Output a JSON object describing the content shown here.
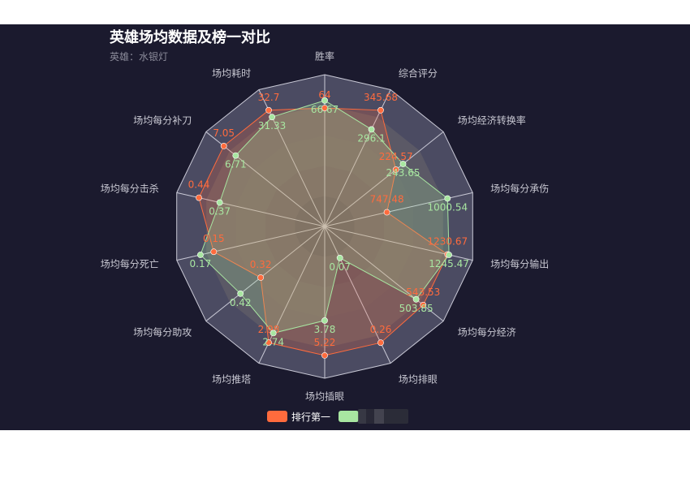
{
  "title": "英雄场均数据及榜一对比",
  "subtitle": "英雄：水银灯",
  "colors": {
    "top": "#ff6b3d",
    "hero": "#a8e6a1",
    "background": "#1b1a2e"
  },
  "legend": [
    {
      "label": "排行第一",
      "color": "#ff6b3d"
    },
    {
      "label": "",
      "color": "#a8e6a1"
    }
  ],
  "chart_data": {
    "type": "radar",
    "indicators": [
      "胜率",
      "综合评分",
      "场均经济转换率",
      "场均每分承伤",
      "场均每分输出",
      "场均每分经济",
      "场均排眼",
      "场均插眼",
      "场均推塔",
      "场均每分助攻",
      "场均每分死亡",
      "场均每分击杀",
      "场均每分补刀",
      "场均耗时"
    ],
    "series": [
      {
        "name": "排行第一",
        "values": [
          64,
          345.68,
          224.57,
          747.48,
          1230.67,
          543.53,
          0.26,
          5.22,
          2.98,
          0.32,
          0.15,
          0.44,
          7.05,
          32.7
        ],
        "labels": [
          "64",
          "345.68",
          "224.57",
          "747.48",
          "1230.67",
          "543.53",
          "0.26",
          "5.22",
          "2.98",
          "0.32",
          "0.15",
          "0.44",
          "7.05",
          "32.7"
        ],
        "r": [
          0.78,
          0.85,
          0.6,
          0.42,
          0.83,
          0.83,
          0.85,
          0.85,
          0.85,
          0.54,
          0.75,
          0.85,
          0.85,
          0.85
        ]
      },
      {
        "values": [
          66.67,
          296.1,
          243.65,
          1000.54,
          1245.47,
          503.85,
          0.07,
          3.78,
          2.74,
          0.42,
          0.17,
          0.37,
          6.71,
          31.33
        ],
        "labels": [
          "66.67",
          "296.1",
          "243.65",
          "1000.54",
          "1245.47",
          "503.85",
          "0.07",
          "3.78",
          "2.74",
          "0.42",
          "0.17",
          "0.37",
          "6.71",
          "31.33"
        ],
        "r": [
          0.83,
          0.71,
          0.66,
          0.83,
          0.84,
          0.77,
          0.23,
          0.62,
          0.78,
          0.71,
          0.84,
          0.71,
          0.75,
          0.8
        ]
      }
    ]
  }
}
